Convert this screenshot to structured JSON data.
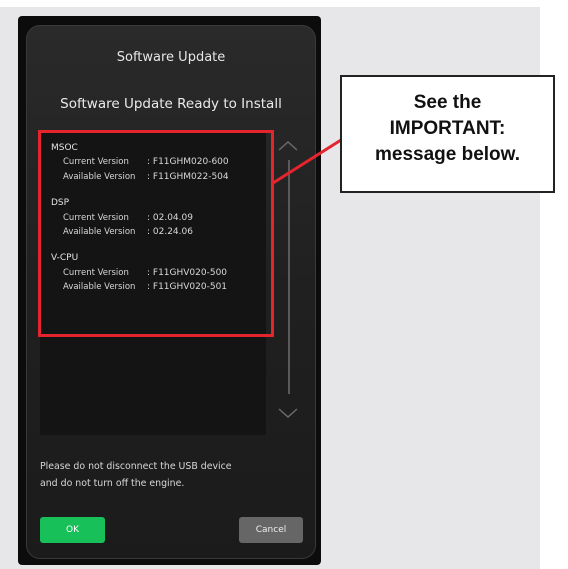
{
  "dialog": {
    "title": "Software Update",
    "subtitle": "Software Update Ready to Install",
    "entries": [
      {
        "name": "MSOC",
        "current_label": "Current Version",
        "current_value": ": F11GHM020-600",
        "available_label": "Available Version",
        "available_value": ": F11GHM022-504"
      },
      {
        "name": "DSP",
        "current_label": "Current Version",
        "current_value": ": 02.04.09",
        "available_label": "Available Version",
        "available_value": ": 02.24.06"
      },
      {
        "name": "V-CPU",
        "current_label": "Current Version",
        "current_value": ": F11GHV020-500",
        "available_label": "Available Version",
        "available_value": ": F11GHV020-501"
      }
    ],
    "message": "Please do not disconnect the USB device\nand do not turn off the engine.",
    "ok_label": "OK",
    "cancel_label": "Cancel"
  },
  "callout": {
    "line1": "See the",
    "line2": "IMPORTANT:",
    "line3": "message below."
  },
  "colors": {
    "ok_button": "#18c05a",
    "callout_red": "#e5242e"
  },
  "icons": {
    "scroll_up": "chevron-up-icon",
    "scroll_down": "chevron-down-icon"
  }
}
